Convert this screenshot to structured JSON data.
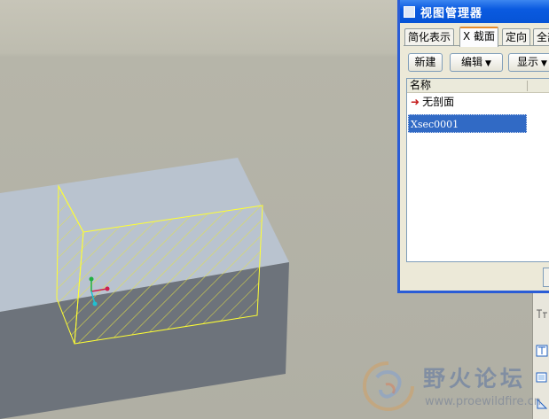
{
  "window": {
    "title": "视图管理器",
    "tabs": [
      {
        "label": "简化表示",
        "active": false
      },
      {
        "label": "X 截面",
        "active": true
      },
      {
        "label": "定向",
        "active": false
      },
      {
        "label": "全部",
        "active": false
      }
    ]
  },
  "toolbar": {
    "new_label": "新建",
    "edit_label": "编辑",
    "display_label": "显示"
  },
  "list": {
    "column_header": "名称",
    "items": [
      {
        "label": "无剖面",
        "icon": "red-arrow-icon"
      },
      {
        "label": "Xsec0001",
        "selected": true
      }
    ]
  },
  "watermark": {
    "title": "野火论坛",
    "url": "www.proewildfire.cn"
  },
  "colors": {
    "titlebar": "#0654d6",
    "selection": "#316ac5",
    "section_outline": "#ffff33",
    "solid_top": "#b9c3cf",
    "solid_front": "#6d737b"
  }
}
